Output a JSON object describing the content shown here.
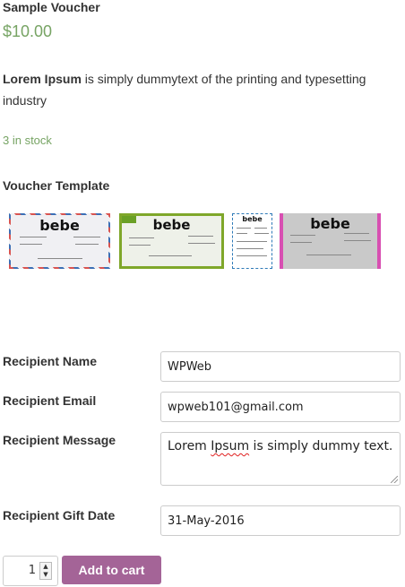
{
  "product": {
    "title": "Sample Voucher",
    "price": "$10.00",
    "description_bold": "Lorem Ipsum",
    "description_rest": " is simply dummytext of the printing and typesetting industry",
    "stock": "3 in stock"
  },
  "voucher_template": {
    "heading": "Voucher Template",
    "brand": "bebe",
    "templates": [
      "template-blue-red-dashed",
      "template-green-frame",
      "template-small-blue-dotted",
      "template-gray-pink-floral"
    ]
  },
  "form": {
    "recipient_name": {
      "label": "Recipient Name",
      "value": "WPWeb"
    },
    "recipient_email": {
      "label": "Recipient Email",
      "value": "wpweb101@gmail.com"
    },
    "recipient_message": {
      "label": "Recipient Message",
      "value_word1": "Lorem",
      "value_word2": "Ipsum",
      "value_rest": " is simply dummy text."
    },
    "recipient_gift_date": {
      "label": "Recipient Gift Date",
      "value": "31-May-2016"
    }
  },
  "cart": {
    "quantity": "1",
    "add_to_cart_label": "Add to cart"
  },
  "colors": {
    "price_green": "#77a464",
    "button_purple": "#a46497"
  }
}
